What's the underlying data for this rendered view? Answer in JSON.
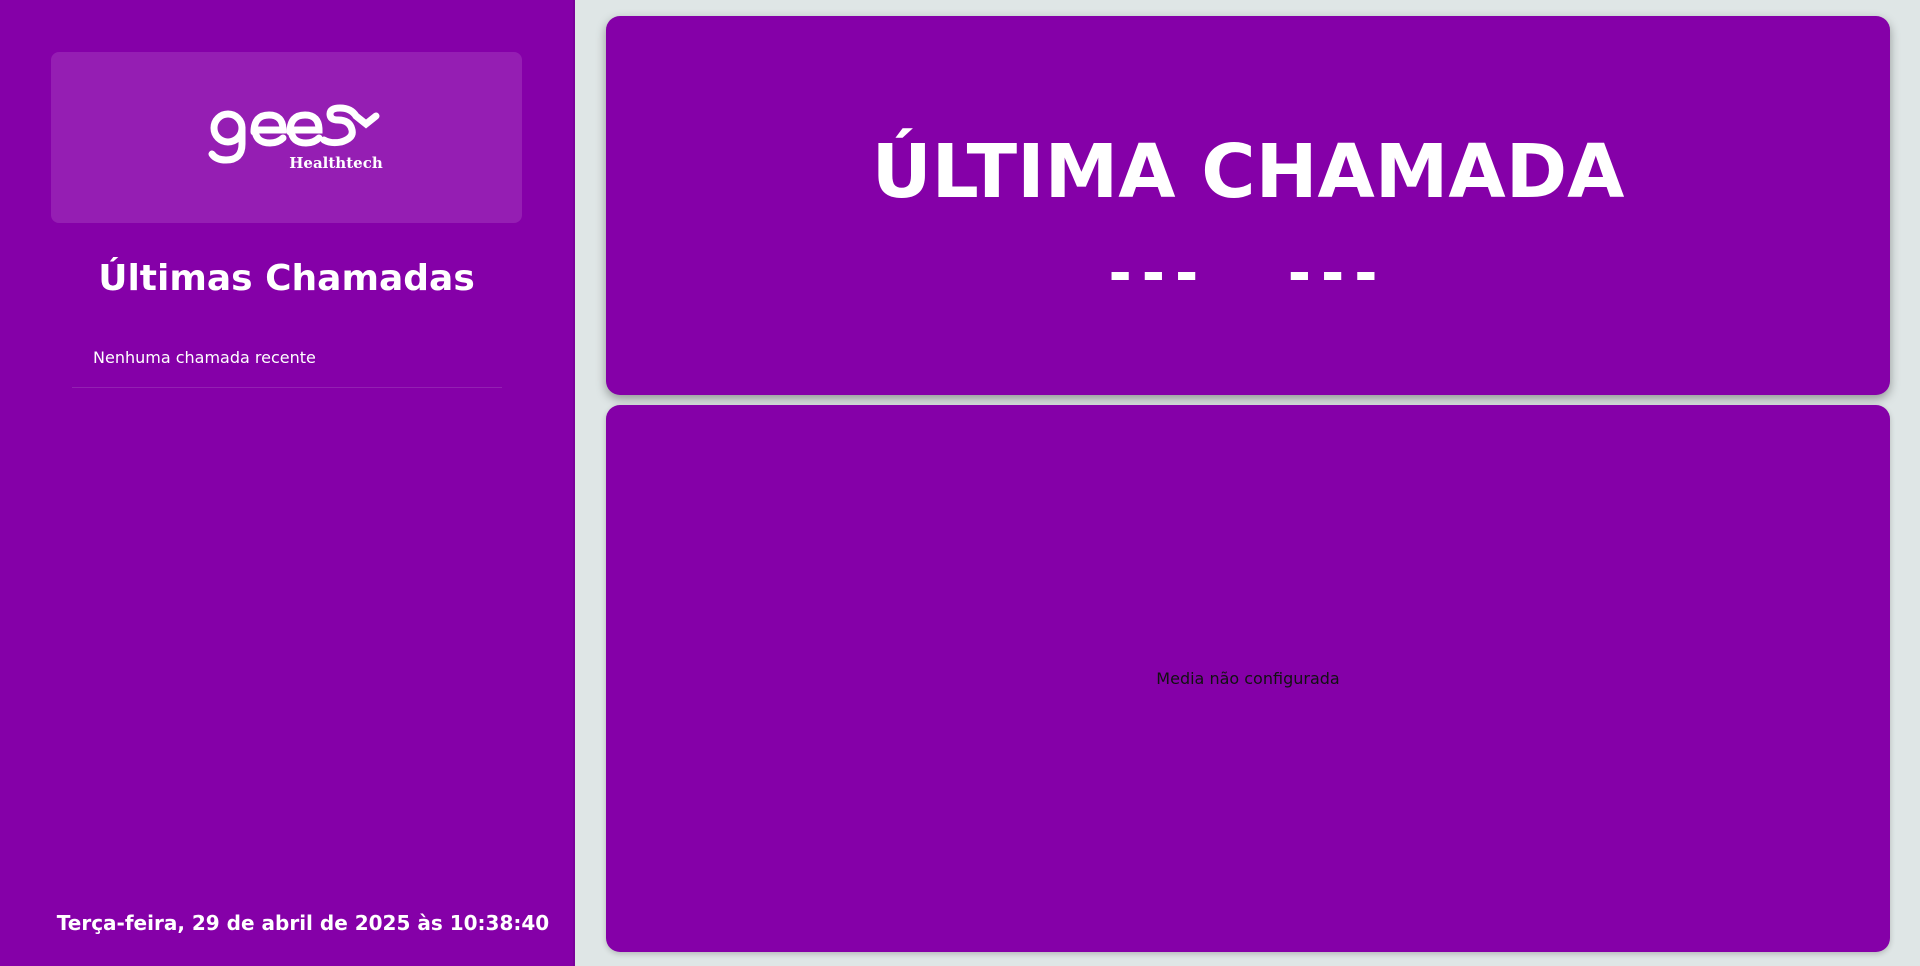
{
  "colors": {
    "primary": "#8500a8",
    "logo_box": "#951eb3",
    "background": "#dfe6e6",
    "text": "#ffffff"
  },
  "logo": {
    "brand": "gees",
    "subtitle": "Healthtech"
  },
  "sidebar": {
    "title": "Últimas Chamadas",
    "empty_message": "Nenhuma chamada recente",
    "datetime": "Terça-feira, 29 de abril de 2025 às 10:38:40"
  },
  "last_call": {
    "title": "ÚLTIMA CHAMADA",
    "ticket": "---",
    "counter": "---"
  },
  "media": {
    "status": "Media não configurada"
  }
}
